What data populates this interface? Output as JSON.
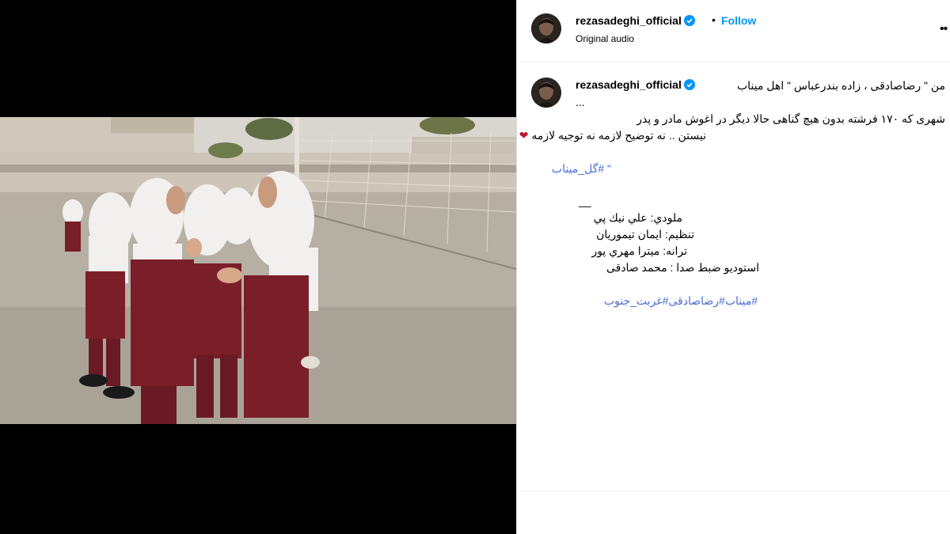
{
  "post": {
    "username": "rezasadeghi_official",
    "follow_label": "Follow",
    "separator": "•",
    "audio_label": "Original audio",
    "more_label": "••"
  },
  "caption": {
    "line1": "من \" رضاصادقی ، زاده بندرعباس \" اهل میناب",
    "line2": "...",
    "line3": "شهری که ۱۷۰ فرشته بدون هیچ گناهی حالا دیگر در اغوش مادر و پدر",
    "line4": "نیستن .. نه توضیح لازمه نه توجیه لازمه",
    "heart": "❤",
    "hashtag_line": "\" #گل_میناب",
    "dash": "__",
    "credit1": "ملودي: علي نيك پي",
    "credit2": "تنظیم: ایمان تیموریان",
    "credit3": "ترانه: میترا مهري پور",
    "credit4": "استوديو ضبط صدا : محمد صادقی",
    "tags": "#میناب#رضاصادقی#غربت_جنوب"
  },
  "colors": {
    "link": "#0095f6",
    "hashtag": "#4a6bd6",
    "uniform": "#7a1f2a",
    "headscarf": "#f2f0ee"
  },
  "icons": {
    "mute": "speaker-muted-icon",
    "verified": "verified-badge-icon"
  }
}
